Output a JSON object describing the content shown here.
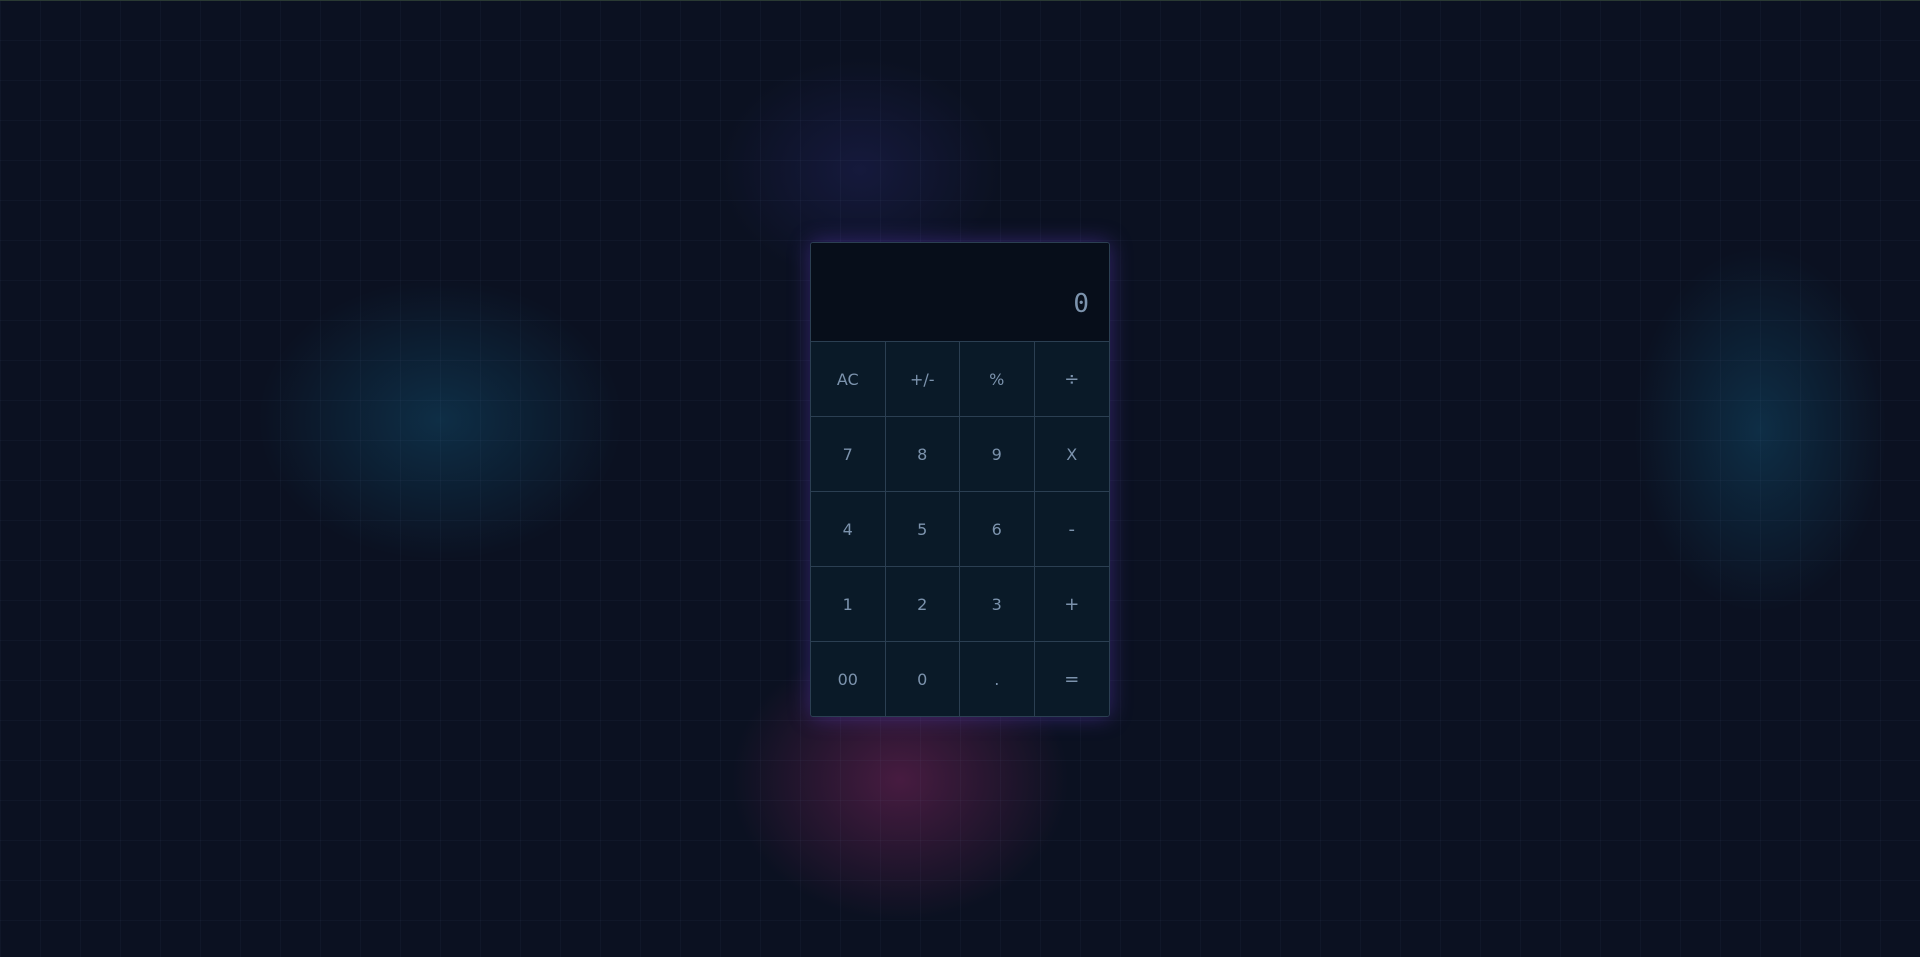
{
  "calculator": {
    "display": "0",
    "keys": [
      {
        "label": "AC",
        "name": "all-clear-button"
      },
      {
        "label": "+/-",
        "name": "toggle-sign-button"
      },
      {
        "label": "%",
        "name": "percent-button"
      },
      {
        "label": "÷",
        "name": "divide-button"
      },
      {
        "label": "7",
        "name": "digit-7-button"
      },
      {
        "label": "8",
        "name": "digit-8-button"
      },
      {
        "label": "9",
        "name": "digit-9-button"
      },
      {
        "label": "X",
        "name": "multiply-button"
      },
      {
        "label": "4",
        "name": "digit-4-button"
      },
      {
        "label": "5",
        "name": "digit-5-button"
      },
      {
        "label": "6",
        "name": "digit-6-button"
      },
      {
        "label": "-",
        "name": "subtract-button"
      },
      {
        "label": "1",
        "name": "digit-1-button"
      },
      {
        "label": "2",
        "name": "digit-2-button"
      },
      {
        "label": "3",
        "name": "digit-3-button"
      },
      {
        "label": "+",
        "name": "add-button"
      },
      {
        "label": "00",
        "name": "double-zero-button"
      },
      {
        "label": "0",
        "name": "digit-0-button"
      },
      {
        "label": ".",
        "name": "decimal-button"
      },
      {
        "label": "=",
        "name": "equals-button"
      }
    ]
  }
}
